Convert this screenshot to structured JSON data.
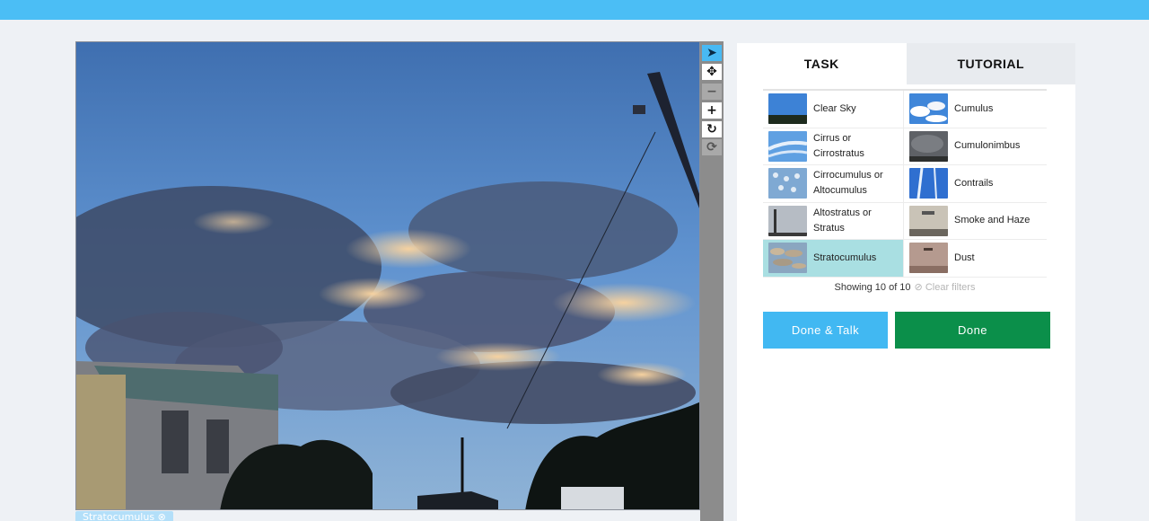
{
  "header": {
    "title": ""
  },
  "subject": {
    "alt": "sky photo with clouds, utility pole and buildings"
  },
  "toolbar": {
    "tools": [
      {
        "name": "pointer-icon",
        "glyph": "➤",
        "state": "active"
      },
      {
        "name": "move-icon",
        "glyph": "✥",
        "state": "normal"
      },
      {
        "name": "zoom-out-icon",
        "glyph": "−",
        "state": "disabled"
      },
      {
        "name": "zoom-in-icon",
        "glyph": "+",
        "state": "normal"
      },
      {
        "name": "rotate-icon",
        "glyph": "↻",
        "state": "normal"
      },
      {
        "name": "reset-icon",
        "glyph": "⟳",
        "state": "disabled"
      }
    ]
  },
  "selected_tag": {
    "label": "Stratocumulus ⊗"
  },
  "tabs": {
    "task": "TASK",
    "tutorial": "TUTORIAL"
  },
  "choices": [
    {
      "label": "Clear Sky",
      "selected": false
    },
    {
      "label": "Cumulus",
      "selected": false
    },
    {
      "label": "Cirrus or Cirrostratus",
      "selected": false
    },
    {
      "label": "Cumulonimbus",
      "selected": false
    },
    {
      "label": "Cirrocumulus or Altocumulus",
      "selected": false
    },
    {
      "label": "Contrails",
      "selected": false
    },
    {
      "label": "Altostratus or Stratus",
      "selected": false
    },
    {
      "label": "Smoke and Haze",
      "selected": false
    },
    {
      "label": "Stratocumulus",
      "selected": true
    },
    {
      "label": "Dust",
      "selected": false
    }
  ],
  "filter": {
    "showing": "Showing 10 of 10",
    "clear": "⊘ Clear filters"
  },
  "buttons": {
    "done_talk": "Done & Talk",
    "done": "Done"
  },
  "colors": {
    "accent": "#41b8f2",
    "done": "#0b8f4a",
    "selected_choice": "#a9dfe2"
  }
}
